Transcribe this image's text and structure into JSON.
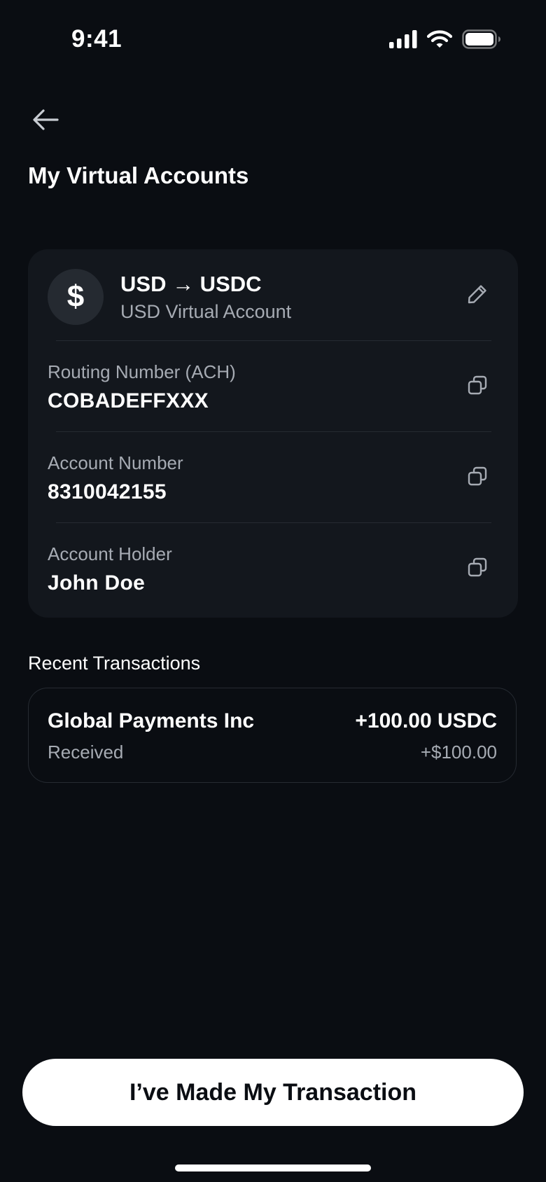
{
  "status_bar": {
    "time": "9:41",
    "icons": [
      "signal-icon",
      "wifi-icon",
      "battery-icon"
    ]
  },
  "header": {
    "back_icon": "arrow-left-icon",
    "title": "My Virtual Accounts"
  },
  "account": {
    "currency_symbol": "$",
    "pair": "USD → USDC",
    "subtitle": "USD Virtual Account",
    "edit_icon": "pencil-icon",
    "fields": [
      {
        "label": "Routing Number (ACH)",
        "value": "COBADEFFXXX",
        "action_icon": "copy-icon"
      },
      {
        "label": "Account Number",
        "value": "8310042155",
        "action_icon": "copy-icon"
      },
      {
        "label": "Account Holder",
        "value": "John Doe",
        "action_icon": "copy-icon"
      }
    ]
  },
  "transactions": {
    "section_title": "Recent Transactions",
    "items": [
      {
        "name": "Global Payments Inc",
        "status": "Received",
        "amount": "+100.00 USDC",
        "fiat": "+$100.00"
      }
    ]
  },
  "footer": {
    "button_label": "I’ve Made My Transaction"
  },
  "colors": {
    "background": "#0a0d12",
    "card": "#13171d",
    "muted_text": "#a6abb3",
    "button_bg": "#ffffff"
  }
}
